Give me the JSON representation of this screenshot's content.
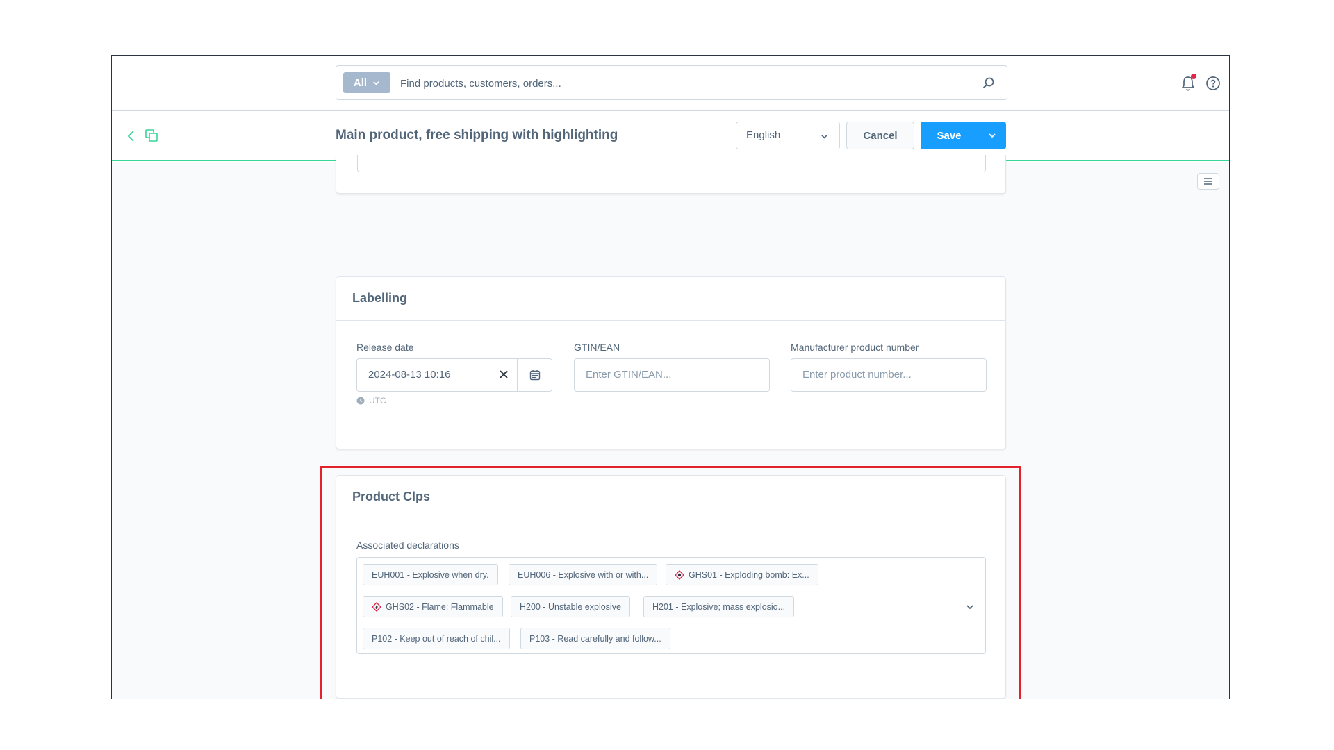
{
  "search": {
    "type_label": "All",
    "placeholder": "Find products, customers, orders..."
  },
  "smartbar": {
    "title": "Main product, free shipping with highlighting",
    "language": "English",
    "cancel_label": "Cancel",
    "save_label": "Save"
  },
  "labelling": {
    "title": "Labelling",
    "release_date_label": "Release date",
    "release_date_value": "2024-08-13 10:16",
    "timezone": "UTC",
    "gtin_label": "GTIN/EAN",
    "gtin_placeholder": "Enter GTIN/EAN...",
    "manufacturer_label": "Manufacturer product number",
    "manufacturer_placeholder": "Enter product number..."
  },
  "clps": {
    "title": "Product Clps",
    "declarations_label": "Associated declarations",
    "tags": [
      {
        "label": "EUH001 - Explosive when dry.",
        "icon": ""
      },
      {
        "label": "EUH006 - Explosive with or with...",
        "icon": ""
      },
      {
        "label": "GHS01 - Exploding bomb: Ex...",
        "icon": "ghs-pictogram-icon"
      },
      {
        "label": "GHS02 - Flame: Flammable",
        "icon": "ghs-pictogram-icon"
      },
      {
        "label": "H200 - Unstable explosive",
        "icon": ""
      },
      {
        "label": "H201 - Explosive; mass explosio...",
        "icon": ""
      },
      {
        "label": "P102 - Keep out of reach of chil...",
        "icon": ""
      },
      {
        "label": "P103 - Read carefully and follow...",
        "icon": ""
      }
    ]
  },
  "colors": {
    "primary": "#189eff",
    "accent_line": "#37d596",
    "highlight": "#e3222b",
    "notification_dot": "#de294c",
    "ghs_red": "#de294c"
  }
}
